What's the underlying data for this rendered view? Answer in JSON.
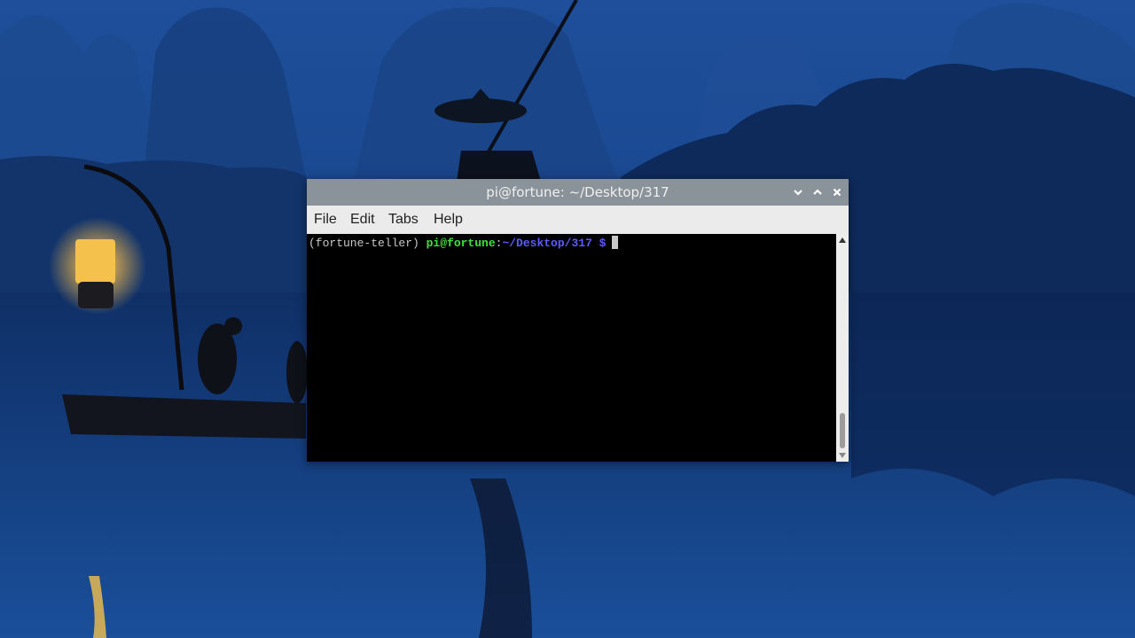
{
  "desktop": {
    "wallpaper": "river-landscape-with-fisherman-and-lantern"
  },
  "window": {
    "title": "pi@fortune: ~/Desktop/317",
    "controls": {
      "minimize_icon": "chevron-down-icon",
      "maximize_icon": "chevron-up-icon",
      "close_icon": "close-icon"
    }
  },
  "menu": {
    "file": "File",
    "edit": "Edit",
    "tabs": "Tabs",
    "help": "Help"
  },
  "terminal": {
    "env": "(fortune-teller) ",
    "user_host": "pi@fortune",
    "colon": ":",
    "path": "~/Desktop/317",
    "prompt_symbol": " $"
  },
  "colors": {
    "titlebar": "#8a9399",
    "menubar": "#ebebeb",
    "prompt_user": "#3ce23c",
    "prompt_path": "#5b5bff",
    "terminal_bg": "#000000"
  }
}
